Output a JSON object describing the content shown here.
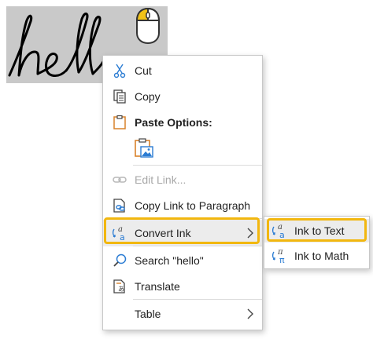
{
  "ink": {
    "text": "hello"
  },
  "context_menu": {
    "items": [
      {
        "label": "Cut",
        "icon": "scissors-icon"
      },
      {
        "label": "Copy",
        "icon": "copy-icon"
      },
      {
        "label": "Paste Options:",
        "icon": "clipboard-icon"
      },
      {
        "label": "Edit Link...",
        "icon": "link-icon",
        "disabled": true
      },
      {
        "label": "Copy Link to Paragraph",
        "icon": "copy-link-icon"
      },
      {
        "label": "Convert Ink",
        "icon": "convert-ink-icon"
      },
      {
        "label": "Search \"hello\"",
        "icon": "search-icon"
      },
      {
        "label": "Translate",
        "icon": "translate-icon"
      },
      {
        "label": "Table",
        "icon": ""
      }
    ]
  },
  "submenu": {
    "items": [
      {
        "label": "Ink to Text",
        "icon": "ink-to-text-icon"
      },
      {
        "label": "Ink to Math",
        "icon": "ink-to-math-icon"
      }
    ]
  },
  "colors": {
    "highlight": "#f2b70f",
    "icon_blue": "#2b7cd3",
    "clipboard_orange": "#d9822b",
    "ink_background": "#c9c9c9"
  }
}
